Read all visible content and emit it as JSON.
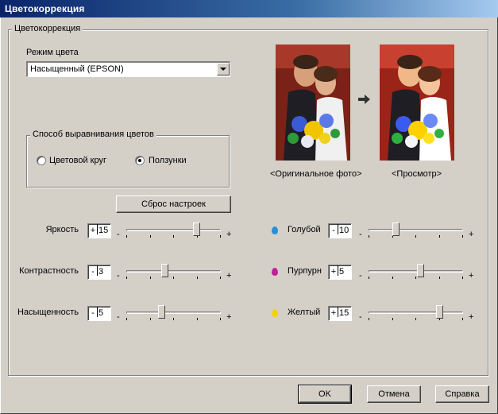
{
  "window": {
    "title": "Цветокоррекция"
  },
  "group_main": {
    "label": "Цветокоррекция"
  },
  "color_mode": {
    "label": "Режим цвета",
    "value": "Насыщенный (EPSON)"
  },
  "alignment": {
    "label": "Способ выравнивания цветов",
    "options": [
      {
        "label": "Цветовой круг",
        "checked": false
      },
      {
        "label": "Ползунки",
        "checked": true
      }
    ]
  },
  "preview": {
    "original_label": "<Оригинальное фото>",
    "preview_label": "<Просмотр>"
  },
  "reset_button": "Сброс настроек",
  "sliders_left": [
    {
      "label": "Яркость",
      "sign": "+",
      "value": "15",
      "level": 0.75
    },
    {
      "label": "Контрастность",
      "sign": "-",
      "value": "3",
      "level": 0.4
    },
    {
      "label": "Насыщенность",
      "sign": "-",
      "value": "5",
      "level": 0.37
    }
  ],
  "sliders_right": [
    {
      "label": "Голубой",
      "sign": "-",
      "value": "10",
      "level": 0.28,
      "color": "#2a8fd6"
    },
    {
      "label": "Пурпурн",
      "sign": "+",
      "value": "5",
      "level": 0.55,
      "color": "#c0209a"
    },
    {
      "label": "Желтый",
      "sign": "+",
      "value": "15",
      "level": 0.76,
      "color": "#f2d400"
    }
  ],
  "slider_signs": {
    "minus": "-",
    "plus": "+"
  },
  "buttons": {
    "ok": "OK",
    "cancel": "Отмена",
    "help": "Справка"
  }
}
